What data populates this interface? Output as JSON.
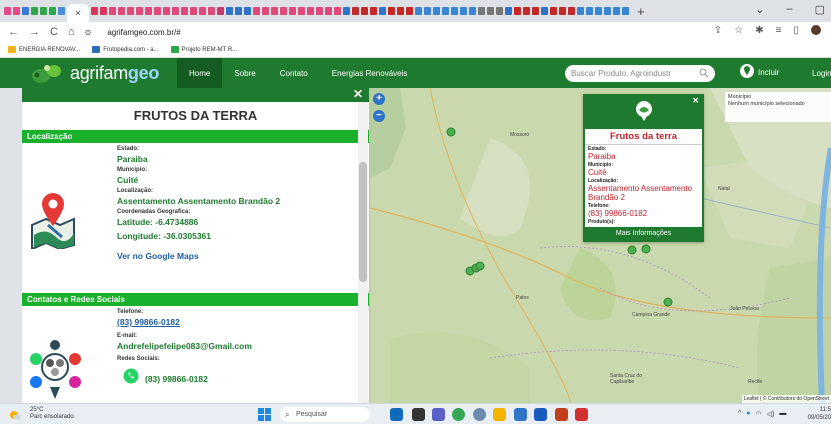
{
  "browser": {
    "url": "agrifamgeo.com.br/#",
    "bookmarks": [
      "ENERGIA RENOVAV...",
      "Frutopedia.com - a...",
      "Projeto REM-MT R..."
    ]
  },
  "nav": {
    "logo_main": "agrifam",
    "logo_suffix": "geo",
    "links": [
      "Home",
      "Sobre",
      "Contato",
      "Energias Renováveis"
    ],
    "search_placeholder": "Buscar Produto, Agroindustr",
    "incluir": "Incluir",
    "login": "Login"
  },
  "panel": {
    "title": "FRUTOS DA TERRA",
    "section_location": "Localização",
    "estado_label": "Estado:",
    "estado": "Paraiba",
    "municipio_label": "Municipio:",
    "municipio": "Cuité",
    "localizacao_label": "Localização:",
    "localizacao": "Assentamento Assentamento Brandão 2",
    "coords_label": "Coordenadas Geografica:",
    "latitude": "Latitude: -6.4734886",
    "longitude": "Longitude: -36.0305361",
    "maps_link": "Ver no Google Maps",
    "section_contacts": "Contatos e Redes Sociais",
    "telefone_label": "Telefone:",
    "telefone": "(83) 99866-0182",
    "email_label": "E-mail:",
    "email": "Andrefelipefelipe083@Gmail.com",
    "redes_label": "Redes Sociais:",
    "whatsapp": "(83) 99866-0182"
  },
  "map": {
    "municipio_box_title": "Municipio",
    "municipio_box_text": "Nenhum município selecionado",
    "labels": {
      "mossoro": "Mossoró",
      "natal": "Natal",
      "patos": "Patos",
      "campina": "Campina Grande",
      "joao": "João Pessoa",
      "recife": "Recife",
      "caruaru": "Santa Cruz do Capibaribe"
    },
    "attribution": "Leaflet | © Contributors do OpenStreet",
    "popup": {
      "title": "Frutos da terra",
      "estado_label": "Estado:",
      "estado": "Paraiba",
      "municipio_label": "Municipio:",
      "municipio": "Cuité",
      "localizacao_label": "Localização:",
      "localizacao": "Assentamento Assentamento Brandão 2",
      "telefone_label": "Telefone:",
      "telefone": "(83) 99866-0182",
      "produtos_label": "Produto(s):",
      "button": "Mais Informações"
    }
  },
  "taskbar": {
    "temp": "25°C",
    "weather": "Parc ensolarado",
    "search": "Pesquisar",
    "time": "11:5",
    "date": "09/05/20"
  }
}
